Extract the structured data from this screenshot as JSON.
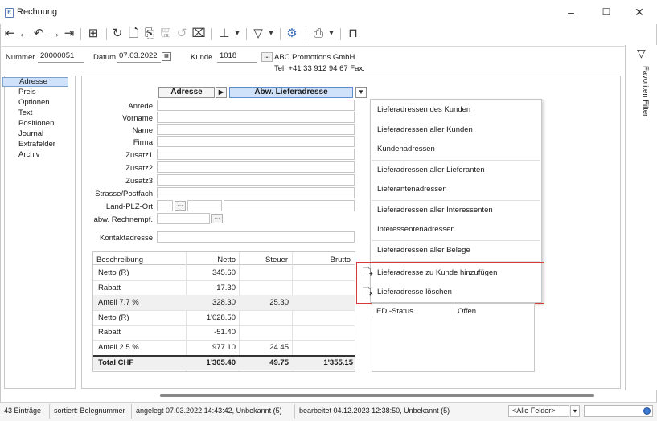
{
  "window": {
    "title": "Rechnung",
    "app_icon": "document-icon",
    "controls": [
      "–",
      "☐",
      "✕"
    ]
  },
  "toolbar": {
    "icons": [
      "first-record-icon",
      "previous-record-icon",
      "undo-icon",
      "next-record-icon",
      "last-record-icon",
      "table-view-icon",
      "refresh-icon",
      "new-document-icon",
      "copy-document-icon",
      "save-icon",
      "undo-changes-icon",
      "delete-document-icon",
      "pin-icon",
      "filter-icon",
      "settings-filter-icon",
      "print-icon",
      "window-icon"
    ]
  },
  "header": {
    "nummer_label": "Nummer",
    "nummer_value": "20000051",
    "datum_label": "Datum",
    "datum_value": "07.03.2022",
    "kunde_label": "Kunde",
    "kunde_value": "1018",
    "kunde_name": "ABC Promotions GmbH",
    "tel_fax": "Tel: +41 33 912 94 67   Fax:"
  },
  "nav": {
    "items": [
      {
        "label": "Adresse",
        "selected": true
      },
      {
        "label": "Preis",
        "selected": false
      },
      {
        "label": "Optionen",
        "selected": false
      },
      {
        "label": "Text",
        "selected": false
      },
      {
        "label": "Positionen",
        "selected": false
      },
      {
        "label": "Journal",
        "selected": false
      },
      {
        "label": "Extrafelder",
        "selected": false
      },
      {
        "label": "Archiv",
        "selected": false
      }
    ]
  },
  "tabs": {
    "adresse": "Adresse",
    "abw_lieferadresse": "Abw. Lieferadresse"
  },
  "form": {
    "labels": [
      "Anrede",
      "Vorname",
      "Name",
      "Firma",
      "Zusatz1",
      "Zusatz2",
      "Zusatz3",
      "Strasse/Postfach",
      "Land-PLZ-Ort",
      "abw. Rechnempf."
    ],
    "kontaktadresse_label": "Kontaktadresse",
    "dots": "..."
  },
  "totals": {
    "headers": [
      "Beschreibung",
      "Netto",
      "Steuer",
      "Brutto"
    ],
    "rows": [
      {
        "desc": "Netto (R)",
        "netto": "345.60",
        "steuer": "",
        "brutto": "",
        "shade": false
      },
      {
        "desc": "Rabatt",
        "netto": "-17.30",
        "steuer": "",
        "brutto": "",
        "shade": false
      },
      {
        "desc": "Anteil 7.7 %",
        "netto": "328.30",
        "steuer": "25.30",
        "brutto": "",
        "shade": true
      },
      {
        "desc": "Netto (R)",
        "netto": "1'028.50",
        "steuer": "",
        "brutto": "",
        "shade": false
      },
      {
        "desc": "Rabatt",
        "netto": "-51.40",
        "steuer": "",
        "brutto": "",
        "shade": false
      },
      {
        "desc": "Anteil 2.5 %",
        "netto": "977.10",
        "steuer": "24.45",
        "brutto": "",
        "shade": false
      },
      {
        "desc": "Total CHF",
        "netto": "1'305.40",
        "steuer": "49.75",
        "brutto": "1'355.15",
        "shade": true,
        "bold": true
      }
    ]
  },
  "context_menu": {
    "items": [
      "Lieferadressen des Kunden",
      "Lieferadressen aller Kunden",
      "Kundenadressen",
      "Lieferadressen aller Lieferanten",
      "Lieferantenadressen",
      "Lieferadressen aller Interessenten",
      "Interessentenadressen",
      "Lieferadressen aller Belege",
      "Lieferadresse zu Kunde hinzufügen",
      "Lieferadresse löschen"
    ],
    "highlight_color": "#d33a3a"
  },
  "edi": {
    "label": "EDI-Status",
    "value": "Offen"
  },
  "right_rail": {
    "filter_icon": "funnel-icon",
    "text": "Favoriten Filter"
  },
  "status": {
    "count": "43 Einträge",
    "sort": "sortiert: Belegnummer",
    "created": "angelegt 07.03.2022 14:43:42, Unbekannt (5)",
    "edited": "bearbeitet 04.12.2023 12:38:50, Unbekannt (5)",
    "field_select": "<Alle Felder>"
  },
  "colors": {
    "accent_blue": "#cfe2fa",
    "highlight_red": "#d33a3a"
  }
}
